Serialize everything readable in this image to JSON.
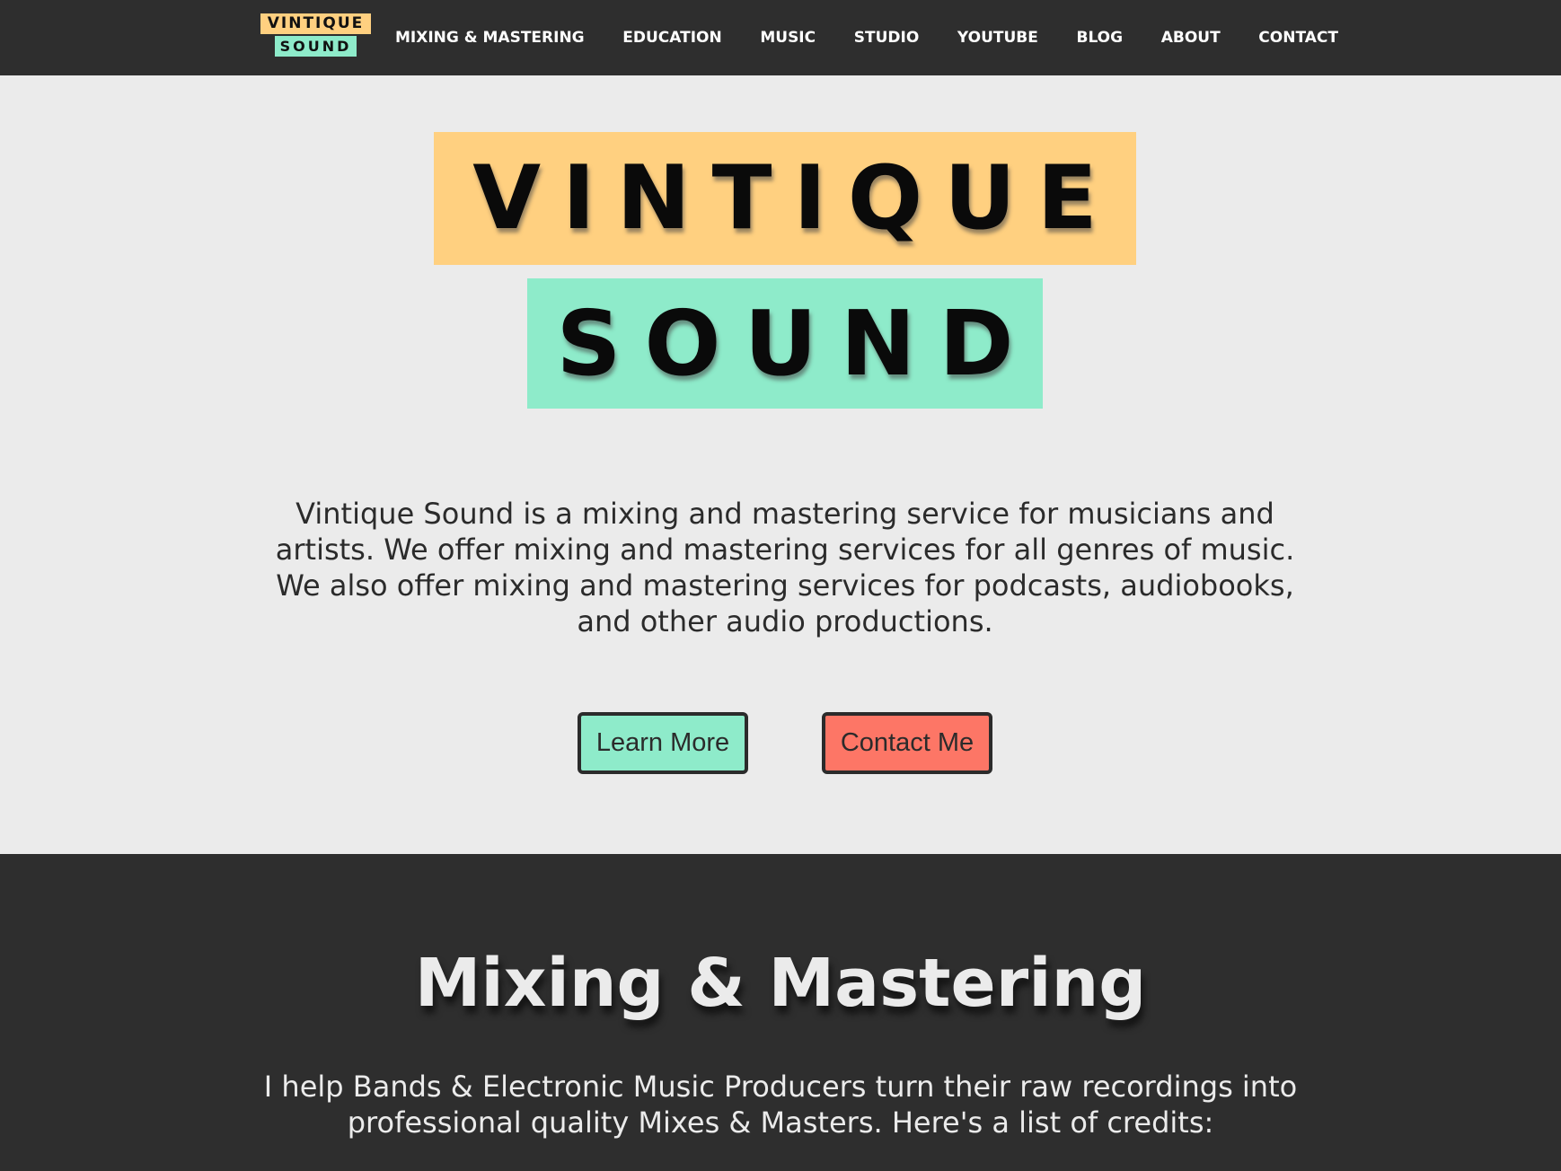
{
  "header": {
    "logo_top": "VINTIQUE",
    "logo_bottom": "SOUND",
    "nav": [
      {
        "label": "MIXING & MASTERING"
      },
      {
        "label": "EDUCATION"
      },
      {
        "label": "MUSIC"
      },
      {
        "label": "STUDIO"
      },
      {
        "label": "YOUTUBE"
      },
      {
        "label": "BLOG"
      },
      {
        "label": "ABOUT"
      },
      {
        "label": "CONTACT"
      }
    ]
  },
  "hero": {
    "logo_top": "VINTIQUE",
    "logo_bottom": "SOUND",
    "description": "Vintique Sound is a mixing and mastering service for musicians and artists. We offer mixing and mastering services for all genres of music. We also offer mixing and mastering services for podcasts, audiobooks, and other audio productions.",
    "learn_more_label": "Learn More",
    "contact_label": "Contact Me"
  },
  "mixing_section": {
    "title": "Mixing & Mastering",
    "description": "I help Bands & Electronic Music Producers turn their raw recordings into professional quality Mixes & Masters. Here's a list of credits:"
  },
  "colors": {
    "dark_bg": "#2e2e2e",
    "light_bg": "#ebebeb",
    "logo_yellow": "#ffd080",
    "logo_mint": "#8eebca",
    "contact_red": "#fd7666"
  }
}
